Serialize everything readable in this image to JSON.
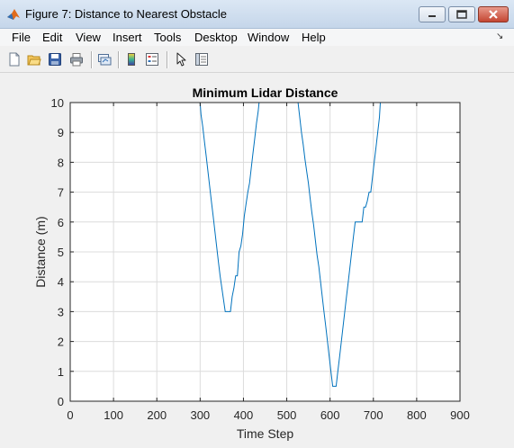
{
  "window": {
    "title": "Figure 7: Distance to Nearest Obstacle",
    "icon": "matlab-icon"
  },
  "menubar": {
    "items": [
      "File",
      "Edit",
      "View",
      "Insert",
      "Tools",
      "Desktop",
      "Window",
      "Help"
    ]
  },
  "toolbar": {
    "buttons": [
      "new-figure-icon",
      "open-file-icon",
      "save-icon",
      "print-icon",
      "link-plot-icon",
      "colorbar-icon",
      "legend-icon",
      "pointer-icon",
      "plot-tools-icon"
    ]
  },
  "colors": {
    "line": "#0072bd",
    "grid": "#dcdcdc",
    "axes_bg": "#ffffff",
    "figure_bg": "#f0f0f0"
  },
  "chart_data": {
    "type": "line",
    "title": "Minimum Lidar Distance",
    "xlabel": "Time Step",
    "ylabel": "Distance (m)",
    "xlim": [
      0,
      900
    ],
    "ylim": [
      0,
      10
    ],
    "xticks": [
      0,
      100,
      200,
      300,
      400,
      500,
      600,
      700,
      800,
      900
    ],
    "yticks": [
      0,
      1,
      2,
      3,
      4,
      5,
      6,
      7,
      8,
      9,
      10
    ],
    "grid": true,
    "series": [
      {
        "x": [
          0,
          300,
          302,
          306,
          310,
          314,
          318,
          322,
          326,
          330,
          334,
          338,
          342,
          346,
          350,
          354,
          358,
          362,
          366,
          370,
          374,
          378,
          382,
          386,
          390,
          394,
          398,
          402,
          406,
          410,
          414,
          418,
          422,
          426,
          430,
          434,
          436,
          440,
          526,
          530,
          534,
          538,
          542,
          546,
          550,
          554,
          558,
          562,
          566,
          570,
          574,
          578,
          582,
          586,
          590,
          594,
          598,
          602,
          606,
          610,
          614,
          618,
          622,
          626,
          630,
          634,
          638,
          642,
          646,
          650,
          654,
          658,
          662,
          666,
          670,
          674,
          678,
          682,
          686,
          690,
          694,
          698,
          702,
          706,
          710,
          714,
          716,
          800
        ],
        "y": [
          10,
          10,
          9.6,
          9.2,
          8.7,
          8.2,
          7.7,
          7.2,
          6.7,
          6.2,
          5.7,
          5.2,
          4.7,
          4.2,
          3.8,
          3.4,
          3.0,
          3.0,
          3.0,
          3.0,
          3.5,
          3.8,
          4.2,
          4.2,
          5.0,
          5.2,
          5.6,
          6.2,
          6.6,
          7.0,
          7.3,
          7.8,
          8.3,
          8.8,
          9.3,
          9.7,
          10,
          10,
          10,
          9.5,
          9.0,
          8.6,
          8.1,
          7.7,
          7.3,
          6.8,
          6.3,
          5.9,
          5.4,
          4.9,
          4.5,
          4.0,
          3.5,
          3.0,
          2.5,
          2.0,
          1.5,
          1.0,
          0.5,
          0.5,
          0.5,
          1.0,
          1.5,
          2.0,
          2.5,
          3.0,
          3.5,
          4.0,
          4.5,
          5.0,
          5.5,
          6.0,
          6.0,
          6.0,
          6.0,
          6.0,
          6.5,
          6.5,
          6.7,
          7.0,
          7.0,
          7.5,
          8.0,
          8.5,
          9.0,
          9.5,
          10,
          10
        ]
      }
    ]
  }
}
